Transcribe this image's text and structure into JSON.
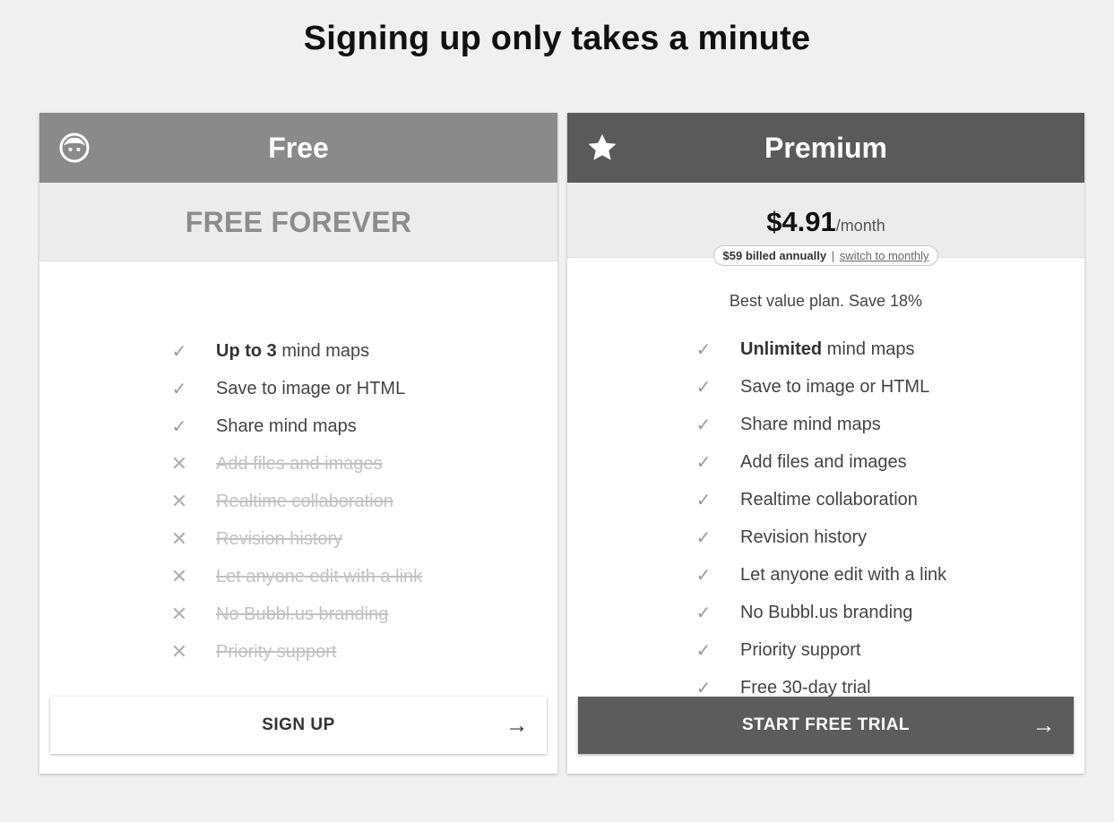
{
  "page": {
    "title": "Signing up only takes a minute"
  },
  "plans": {
    "free": {
      "name": "Free",
      "icon": "face-icon",
      "price_label": "FREE FOREVER",
      "features": [
        {
          "bold": "Up to 3",
          "text": " mind maps",
          "included": true
        },
        {
          "bold": "",
          "text": "Save to image or HTML",
          "included": true
        },
        {
          "bold": "",
          "text": "Share mind maps",
          "included": true
        },
        {
          "bold": "",
          "text": "Add files and images",
          "included": false
        },
        {
          "bold": "",
          "text": "Realtime collaboration",
          "included": false
        },
        {
          "bold": "",
          "text": "Revision history",
          "included": false
        },
        {
          "bold": "",
          "text": "Let anyone edit with a link",
          "included": false
        },
        {
          "bold": "",
          "text": "No Bubbl.us branding",
          "included": false
        },
        {
          "bold": "",
          "text": "Priority support",
          "included": false
        }
      ],
      "cta_label": "SIGN UP",
      "cta_arrow": "→"
    },
    "premium": {
      "name": "Premium",
      "icon": "star-icon",
      "price_amount": "$4.91",
      "price_period": "/month",
      "billing_text": "$59 billed annually",
      "billing_separator": "|",
      "billing_switch": "switch to monthly",
      "value_note": "Best value plan. Save 18%",
      "features": [
        {
          "bold": "Unlimited",
          "text": " mind maps",
          "included": true
        },
        {
          "bold": "",
          "text": "Save to image or HTML",
          "included": true
        },
        {
          "bold": "",
          "text": "Share mind maps",
          "included": true
        },
        {
          "bold": "",
          "text": "Add files and images",
          "included": true
        },
        {
          "bold": "",
          "text": "Realtime collaboration",
          "included": true
        },
        {
          "bold": "",
          "text": "Revision history",
          "included": true
        },
        {
          "bold": "",
          "text": "Let anyone edit with a link",
          "included": true
        },
        {
          "bold": "",
          "text": "No Bubbl.us branding",
          "included": true
        },
        {
          "bold": "",
          "text": "Priority support",
          "included": true
        },
        {
          "bold": "",
          "text": "Free 30-day trial",
          "included": true
        }
      ],
      "cta_label": "START FREE TRIAL",
      "cta_arrow": "→"
    }
  },
  "marks": {
    "check": "✓",
    "cross": "✕"
  },
  "colors": {
    "free_header": "#8a8a8a",
    "premium_header": "#5a5a5a",
    "price_band": "#ececec"
  }
}
